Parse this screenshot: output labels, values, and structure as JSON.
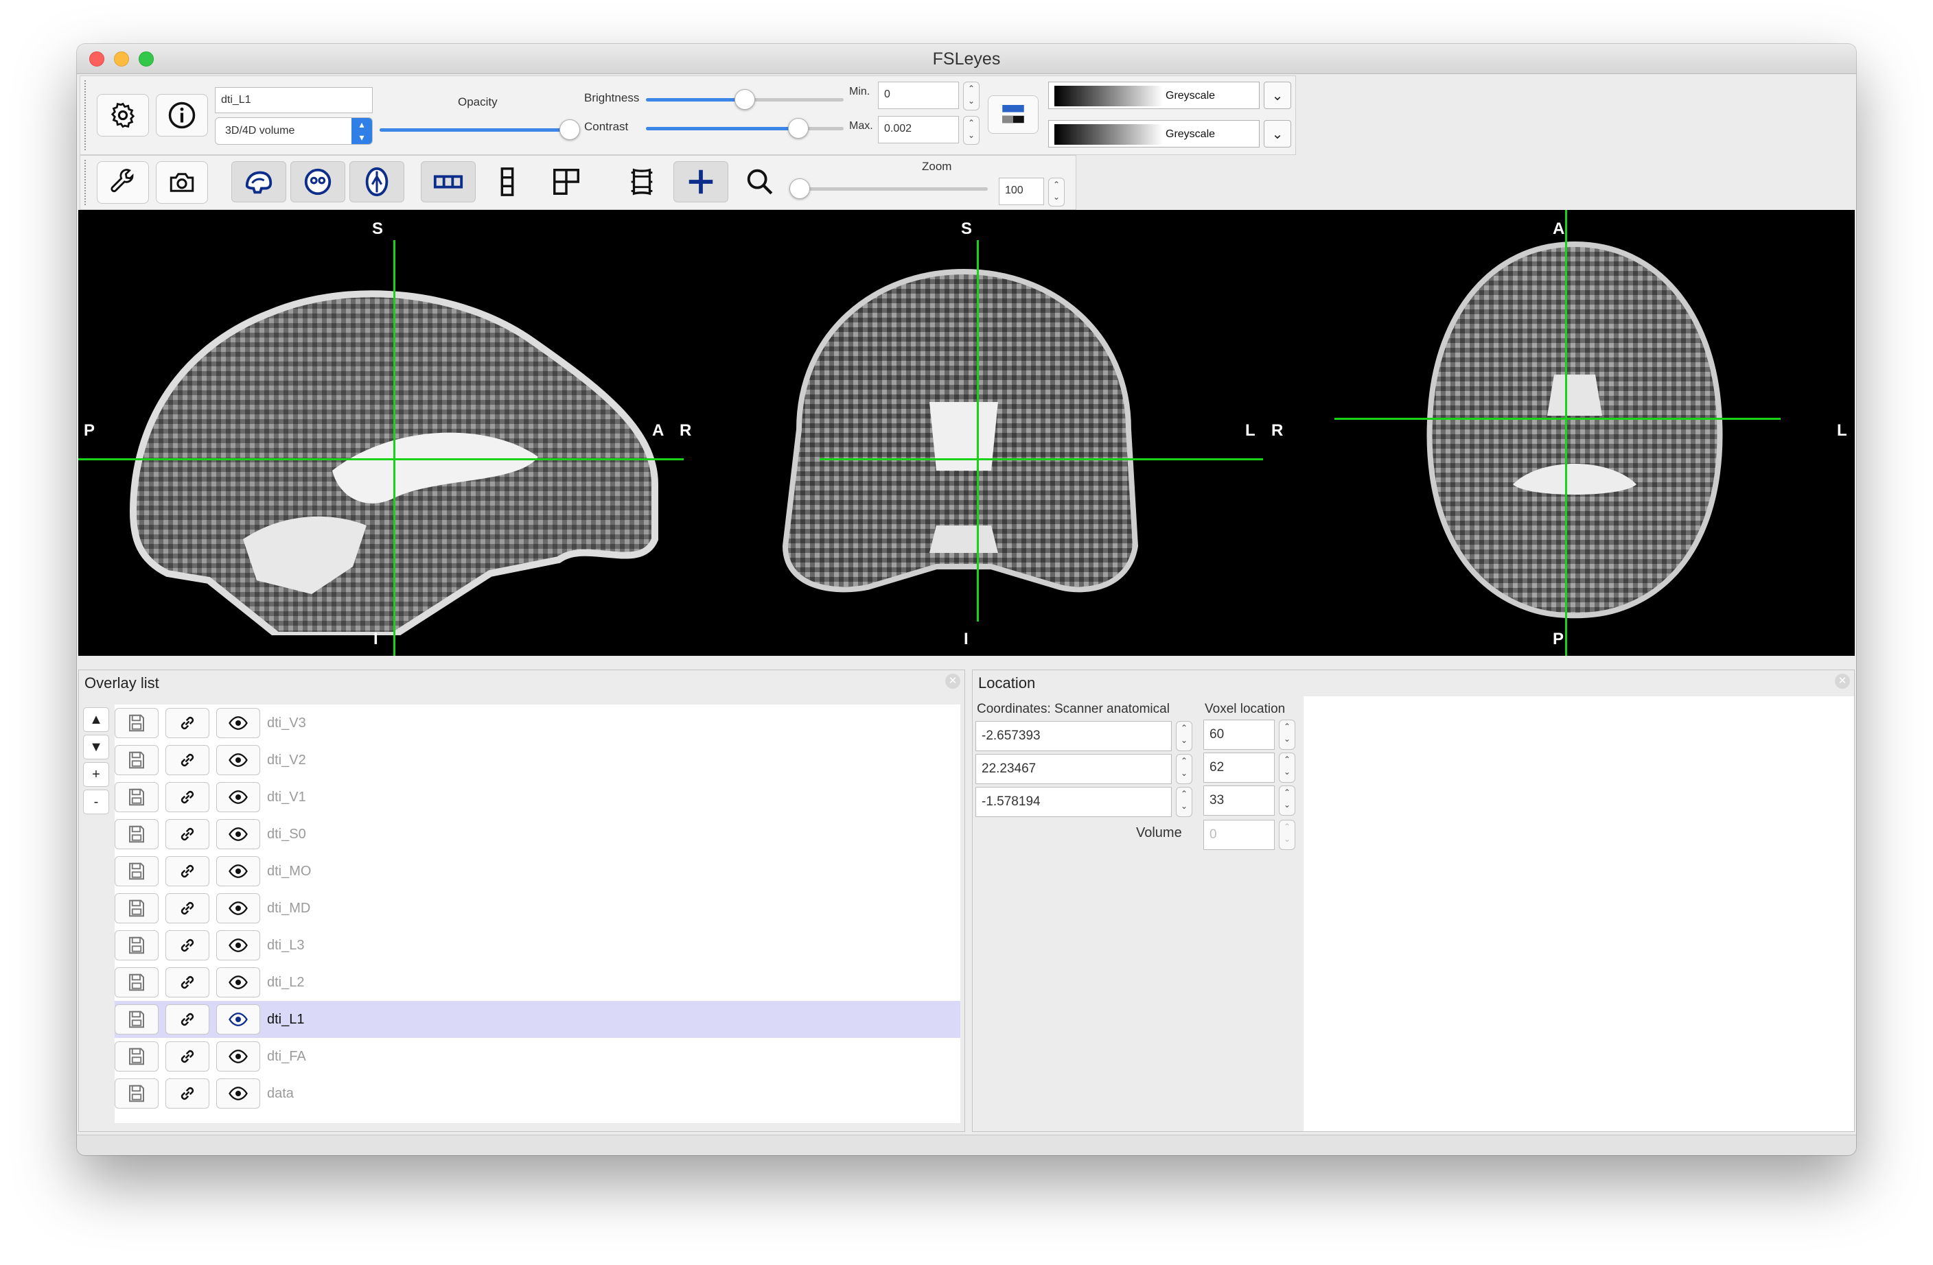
{
  "window": {
    "title": "FSLeyes"
  },
  "overlay_toolbar": {
    "overlay_name": "dti_L1",
    "overlay_type": "3D/4D volume",
    "opacity_label": "Opacity",
    "opacity_value": 0.99,
    "brightness_label": "Brightness",
    "brightness_value": 0.5,
    "contrast_label": "Contrast",
    "contrast_value": 0.77,
    "min_label": "Min.",
    "min_value": "0",
    "max_label": "Max.",
    "max_value": "0.002",
    "colormap_1": "Greyscale",
    "colormap_2": "Greyscale"
  },
  "ortho_toolbar": {
    "zoom_label": "Zoom",
    "zoom_value": "100",
    "zoom_slider": 0
  },
  "icons": [
    "gear-icon",
    "info-icon",
    "wrench-icon",
    "camera-icon",
    "sagittal-icon",
    "coronal-icon",
    "axial-icon",
    "horizontal-layout-icon",
    "vertical-layout-icon",
    "grid-layout-icon",
    "movie-icon",
    "crosshair-icon",
    "zoom-icon",
    "save-icon",
    "link-icon",
    "eye-icon"
  ],
  "views": {
    "sagittal": {
      "top": "S",
      "bottom": "I",
      "left": "P",
      "right": "A"
    },
    "coronal": {
      "top": "S",
      "bottom": "I",
      "left": "R",
      "right": "L"
    },
    "axial": {
      "top": "A",
      "bottom": "P",
      "left": "R",
      "right": "L"
    }
  },
  "crosshair_color": "#18d318",
  "overlay_list": {
    "title": "Overlay list",
    "side_buttons": [
      "▲",
      "▼",
      "+",
      "-"
    ],
    "items": [
      {
        "name": "dti_V3",
        "selected": false
      },
      {
        "name": "dti_V2",
        "selected": false
      },
      {
        "name": "dti_V1",
        "selected": false
      },
      {
        "name": "dti_S0",
        "selected": false
      },
      {
        "name": "dti_MO",
        "selected": false
      },
      {
        "name": "dti_MD",
        "selected": false
      },
      {
        "name": "dti_L3",
        "selected": false
      },
      {
        "name": "dti_L2",
        "selected": false
      },
      {
        "name": "dti_L1",
        "selected": true
      },
      {
        "name": "dti_FA",
        "selected": false
      },
      {
        "name": "data",
        "selected": false
      }
    ]
  },
  "location_panel": {
    "title": "Location",
    "coords_label": "Coordinates: Scanner anatomical",
    "voxel_label": "Voxel location",
    "coords": [
      "-2.657393",
      "22.23467",
      "-1.578194"
    ],
    "voxels": [
      "60",
      "62",
      "33"
    ],
    "volume_label": "Volume",
    "volume_value": "0"
  }
}
